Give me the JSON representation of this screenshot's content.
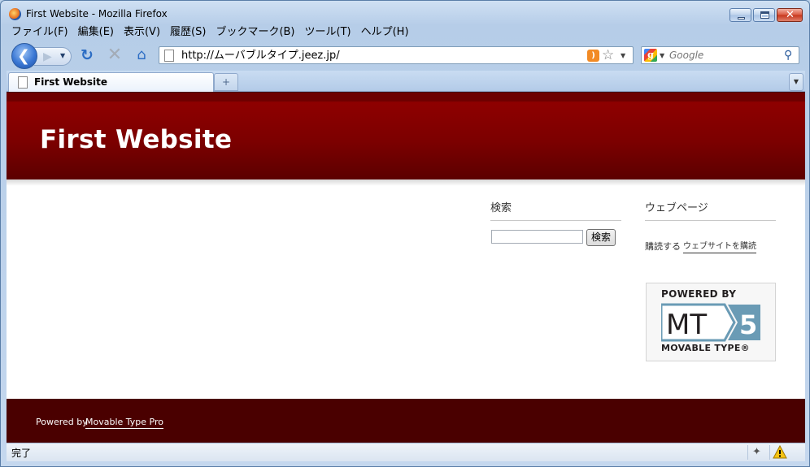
{
  "window": {
    "title": "First Website - Mozilla Firefox"
  },
  "menubar": {
    "items": [
      {
        "label": "ファイル(F)"
      },
      {
        "label": "編集(E)"
      },
      {
        "label": "表示(V)"
      },
      {
        "label": "履歴(S)"
      },
      {
        "label": "ブックマーク(B)"
      },
      {
        "label": "ツール(T)"
      },
      {
        "label": "ヘルプ(H)"
      }
    ]
  },
  "navbar": {
    "url": "http://ムーバブルタイプ.jeez.jp/",
    "search_placeholder": "Google"
  },
  "tabs": [
    {
      "label": "First Website",
      "active": true
    }
  ],
  "page": {
    "site_title": "First Website",
    "search_widget": {
      "title": "検索",
      "button_label": "検索",
      "value": ""
    },
    "webpage_widget": {
      "title": "ウェブページ",
      "subscribe_label": "購読する",
      "subscribe_link": "ウェブサイトを購読"
    },
    "badge": {
      "powered_by": "POWERED BY",
      "mt": "MT",
      "version": "5",
      "caption": "MOVABLE TYPE®"
    },
    "footer": {
      "label": "Powered by",
      "link": "Movable Type Pro"
    }
  },
  "statusbar": {
    "text": "完了"
  },
  "colors": {
    "header_red": "#7c0000",
    "footer_red": "#4a0000",
    "mt_blue": "#6a9bb5"
  },
  "icons": {
    "back": "back-arrow-icon",
    "forward": "forward-arrow-icon",
    "reload": "reload-icon",
    "stop": "stop-icon",
    "home": "home-icon",
    "rss": "rss-feed-icon",
    "bookmark": "star-icon",
    "search": "magnifier-icon",
    "warning": "warning-icon"
  }
}
